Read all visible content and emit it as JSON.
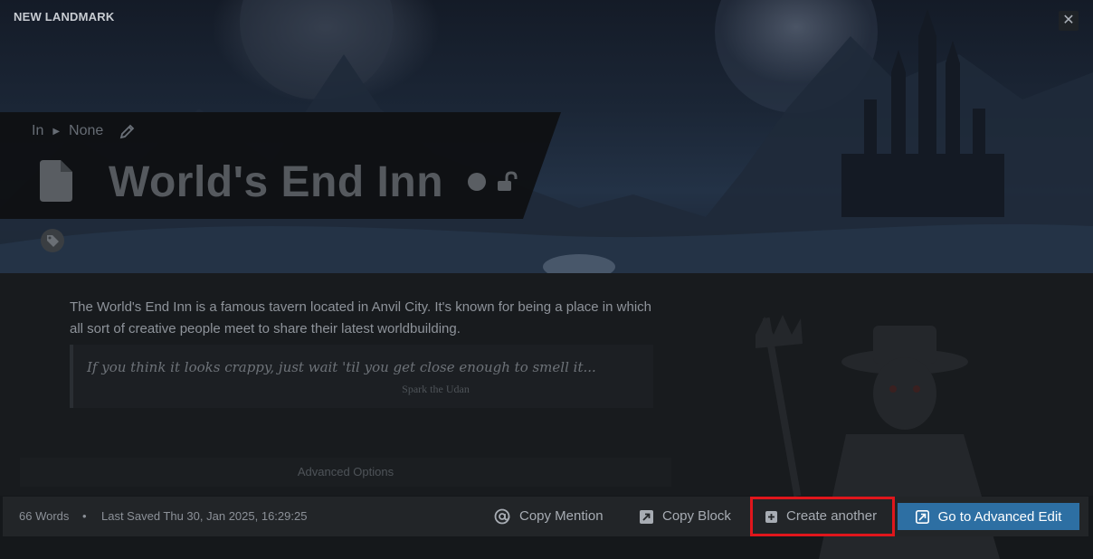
{
  "modal": {
    "title": "NEW LANDMARK",
    "close_label": "✕"
  },
  "header": {
    "breadcrumb_prefix": "In",
    "breadcrumb_parent": "None",
    "page_title": "World's End Inn"
  },
  "content": {
    "description": "The World's End Inn is a famous tavern located in Anvil City. It's known for being a place in which all sort of creative people meet to share their latest worldbuilding.",
    "quote_text": "If you think it looks crappy, just wait 'til you get close enough to smell it...",
    "quote_author": "Spark the Udan",
    "advanced_options_label": "Advanced Options"
  },
  "footer": {
    "word_count": "66 Words",
    "separator": "•",
    "last_saved": "Last Saved Thu 30, Jan 2025, 16:29:25",
    "copy_mention_label": "Copy Mention",
    "copy_block_label": "Copy Block",
    "create_another_label": "Create another",
    "advanced_edit_label": "Go to Advanced Edit"
  },
  "icons": {
    "close": "close-icon",
    "edit": "pencil-icon",
    "document": "document-icon",
    "privacy": "circle-dot-icon",
    "lock": "unlock-icon",
    "tag": "tag-icon",
    "mention": "at-icon",
    "block": "external-link-icon",
    "create": "plus-square-icon",
    "advanced": "external-link-icon"
  },
  "colors": {
    "primary_button": "#2d6fa3",
    "highlight_box": "#e0161c"
  }
}
